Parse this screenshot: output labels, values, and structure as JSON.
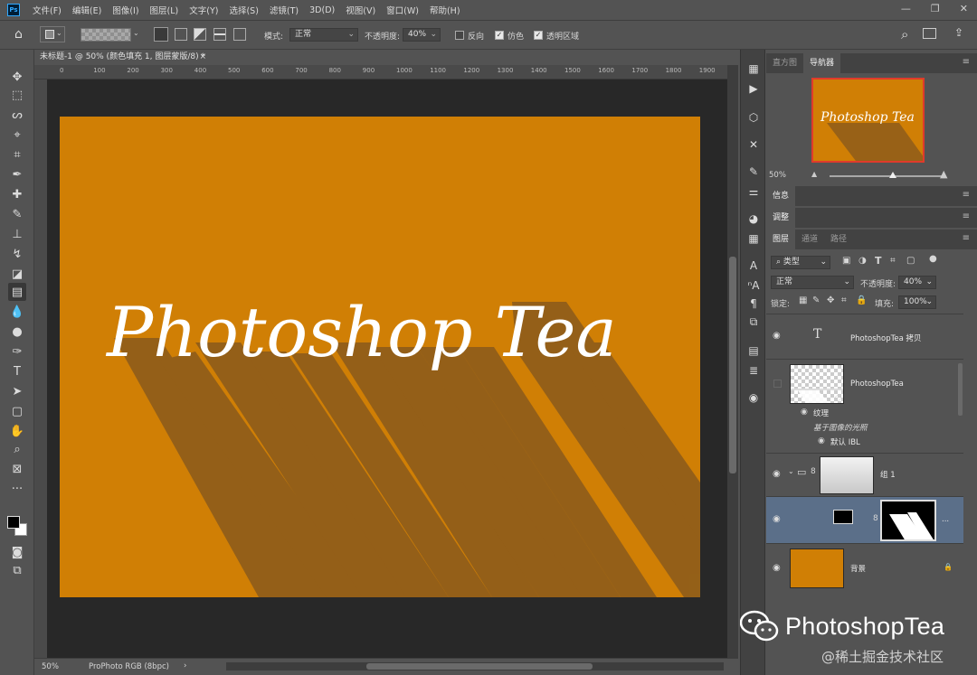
{
  "app": {
    "logo": "Ps",
    "menu": [
      "文件(F)",
      "编辑(E)",
      "图像(I)",
      "图层(L)",
      "文字(Y)",
      "选择(S)",
      "滤镜(T)",
      "3D(D)",
      "视图(V)",
      "窗口(W)",
      "帮助(H)"
    ],
    "window_controls": [
      "—",
      "❐",
      "✕"
    ]
  },
  "options": {
    "mode_label": "模式:",
    "mode_value": "正常",
    "opacity_label": "不透明度:",
    "opacity_value": "40%",
    "reverse_label": "反向",
    "dither_label": "仿色",
    "transparency_label": "透明区域",
    "reverse_checked": false,
    "dither_checked": true,
    "transparency_checked": true
  },
  "document": {
    "tab_title": "未标题-1 @ 50% (颜色填充 1, 图层蒙版/8) *",
    "tab_close": "×",
    "ruler_ticks": [
      "0",
      "100",
      "200",
      "300",
      "400",
      "500",
      "600",
      "700",
      "800",
      "900",
      "1000",
      "1100",
      "1200",
      "1300",
      "1400",
      "1500",
      "1600",
      "1700",
      "1800",
      "1900"
    ],
    "canvas_text": "Photoshop Tea",
    "canvas_color": "#d07f05",
    "shadow_color": "#8a5a1c"
  },
  "status": {
    "zoom": "50%",
    "profile": "ProPhoto RGB (8bpc)",
    "arrow": "›"
  },
  "panels": {
    "top_tabs": [
      "直方图",
      "导航器"
    ],
    "nav_zoom": "50%",
    "info_tab": "信息",
    "adjust_tab": "调整",
    "layer_tabs": [
      "图层",
      "通道",
      "路径"
    ],
    "filter_kind": "类型",
    "blend_mode": "正常",
    "opacity_label": "不透明度:",
    "opacity_value": "40%",
    "lock_label": "锁定:",
    "fill_label": "填充:",
    "fill_value": "100%"
  },
  "layers": [
    {
      "name": "PhotoshopTea 拷贝",
      "kind": "text"
    },
    {
      "name": "PhotoshopTea",
      "kind": "3d"
    },
    {
      "name": "纹理",
      "kind": "sub"
    },
    {
      "name": "基于图像的光照",
      "kind": "sub-italic"
    },
    {
      "name": "默认 IBL",
      "kind": "sub"
    },
    {
      "name": "组 1",
      "kind": "group"
    },
    {
      "name": "...",
      "kind": "fill-mask"
    },
    {
      "name": "背景",
      "kind": "background"
    }
  ],
  "watermark": {
    "brand": "PhotoshopTea",
    "sub": "@稀土掘金技术社区"
  }
}
